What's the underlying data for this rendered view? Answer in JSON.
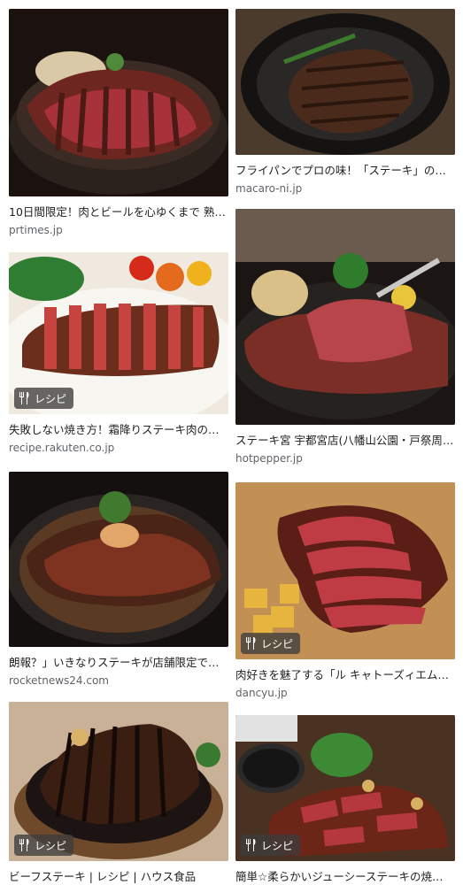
{
  "results": [
    {
      "caption": "10日間限定！肉とビールを心ゆくまで 熟…",
      "source": "prtimes.jp"
    },
    {
      "caption": "フライパンでプロの味！「ステーキ」の…",
      "source": "macaro-ni.jp"
    },
    {
      "caption": "失敗しない焼き方！霜降りステーキ肉の…",
      "source": "recipe.rakuten.co.jp",
      "badge": "レシピ"
    },
    {
      "caption": "ステーキ宮 宇都宮店(八幡山公園・戸祭周…",
      "source": "hotpepper.jp"
    },
    {
      "caption": "朗報？」いきなりステーキが店舗限定で…",
      "source": "rocketnews24.com"
    },
    {
      "caption": "肉好きを魅了する「ル キャトーズィエム…",
      "source": "dancyu.jp",
      "badge": "レシピ"
    },
    {
      "caption": "ビーフステーキ | レシピ | ハウス食品",
      "source": "",
      "badge": "レシピ"
    },
    {
      "caption": "簡単☆柔らかいジューシーステーキの焼…",
      "source": "",
      "badge": "レシピ"
    }
  ],
  "icons": {
    "badge_icon": "fork-knife-icon"
  },
  "colors": {
    "badge_bg": "#3c3c3c",
    "caption": "#202124",
    "source": "#5f6368"
  }
}
